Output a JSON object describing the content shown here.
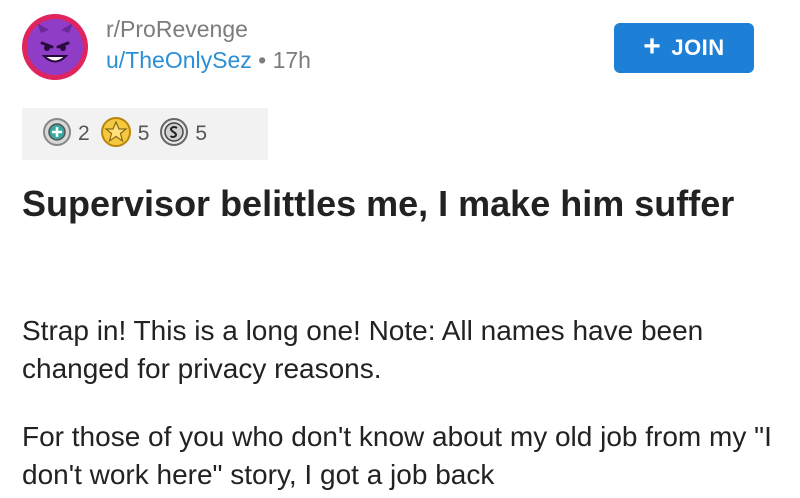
{
  "header": {
    "subreddit": "r/ProRevenge",
    "username": "u/TheOnlySez",
    "separator": "•",
    "time": "17h",
    "join_label": "JOIN"
  },
  "awards": [
    {
      "icon": "helpful-award-icon",
      "count": "2"
    },
    {
      "icon": "gold-award-icon",
      "count": "5"
    },
    {
      "icon": "silver-award-icon",
      "count": "5"
    }
  ],
  "post": {
    "title": "Supervisor belittles me, I make him suffer",
    "paragraphs": [
      "Strap in! This is a long one! Note: All names have been changed for privacy reasons.",
      "For those of you who don't know about my old job from my \"I don't work here\" story, I got a job back"
    ]
  },
  "colors": {
    "accent": "#1d7fd6",
    "username": "#2b8fd6",
    "avatar_ring": "#e0245e",
    "avatar_fill": "#8f3cc7"
  }
}
